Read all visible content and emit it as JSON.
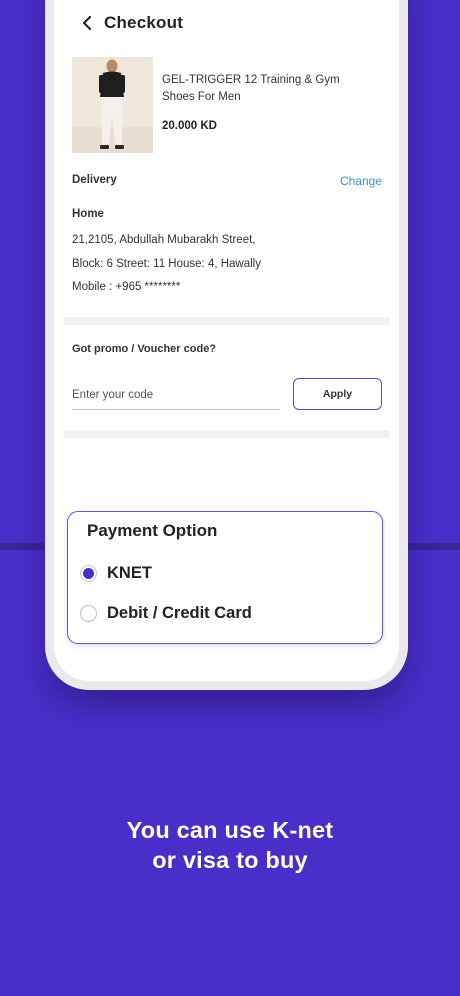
{
  "colors": {
    "background": "#4a2ec9",
    "accent": "#4a2ec9",
    "link": "#3f8fd8"
  },
  "header": {
    "back_icon": "chevron-left-icon",
    "title": "Checkout"
  },
  "product": {
    "name_line1": "GEL-TRIGGER 12 Training & Gym",
    "name_line2": "Shoes For Men",
    "price": "20.000 KD"
  },
  "delivery": {
    "label": "Delivery",
    "change_label": "Change",
    "address_type": "Home",
    "address_line1": "21,2105, Abdullah Mubarakh Street,",
    "address_line2": "Block: 6 Street: 11 House: 4, Hawally",
    "mobile": "Mobile : +965 ********"
  },
  "promo": {
    "label": "Got promo / Voucher code?",
    "placeholder": "Enter your code",
    "apply_label": "Apply"
  },
  "payment": {
    "title": "Payment Option",
    "options": [
      {
        "label": "KNET",
        "selected": true
      },
      {
        "label": "Debit / Credit Card",
        "selected": false
      }
    ]
  },
  "caption": {
    "line1": "You can use K-net",
    "line2": "or visa to buy"
  }
}
